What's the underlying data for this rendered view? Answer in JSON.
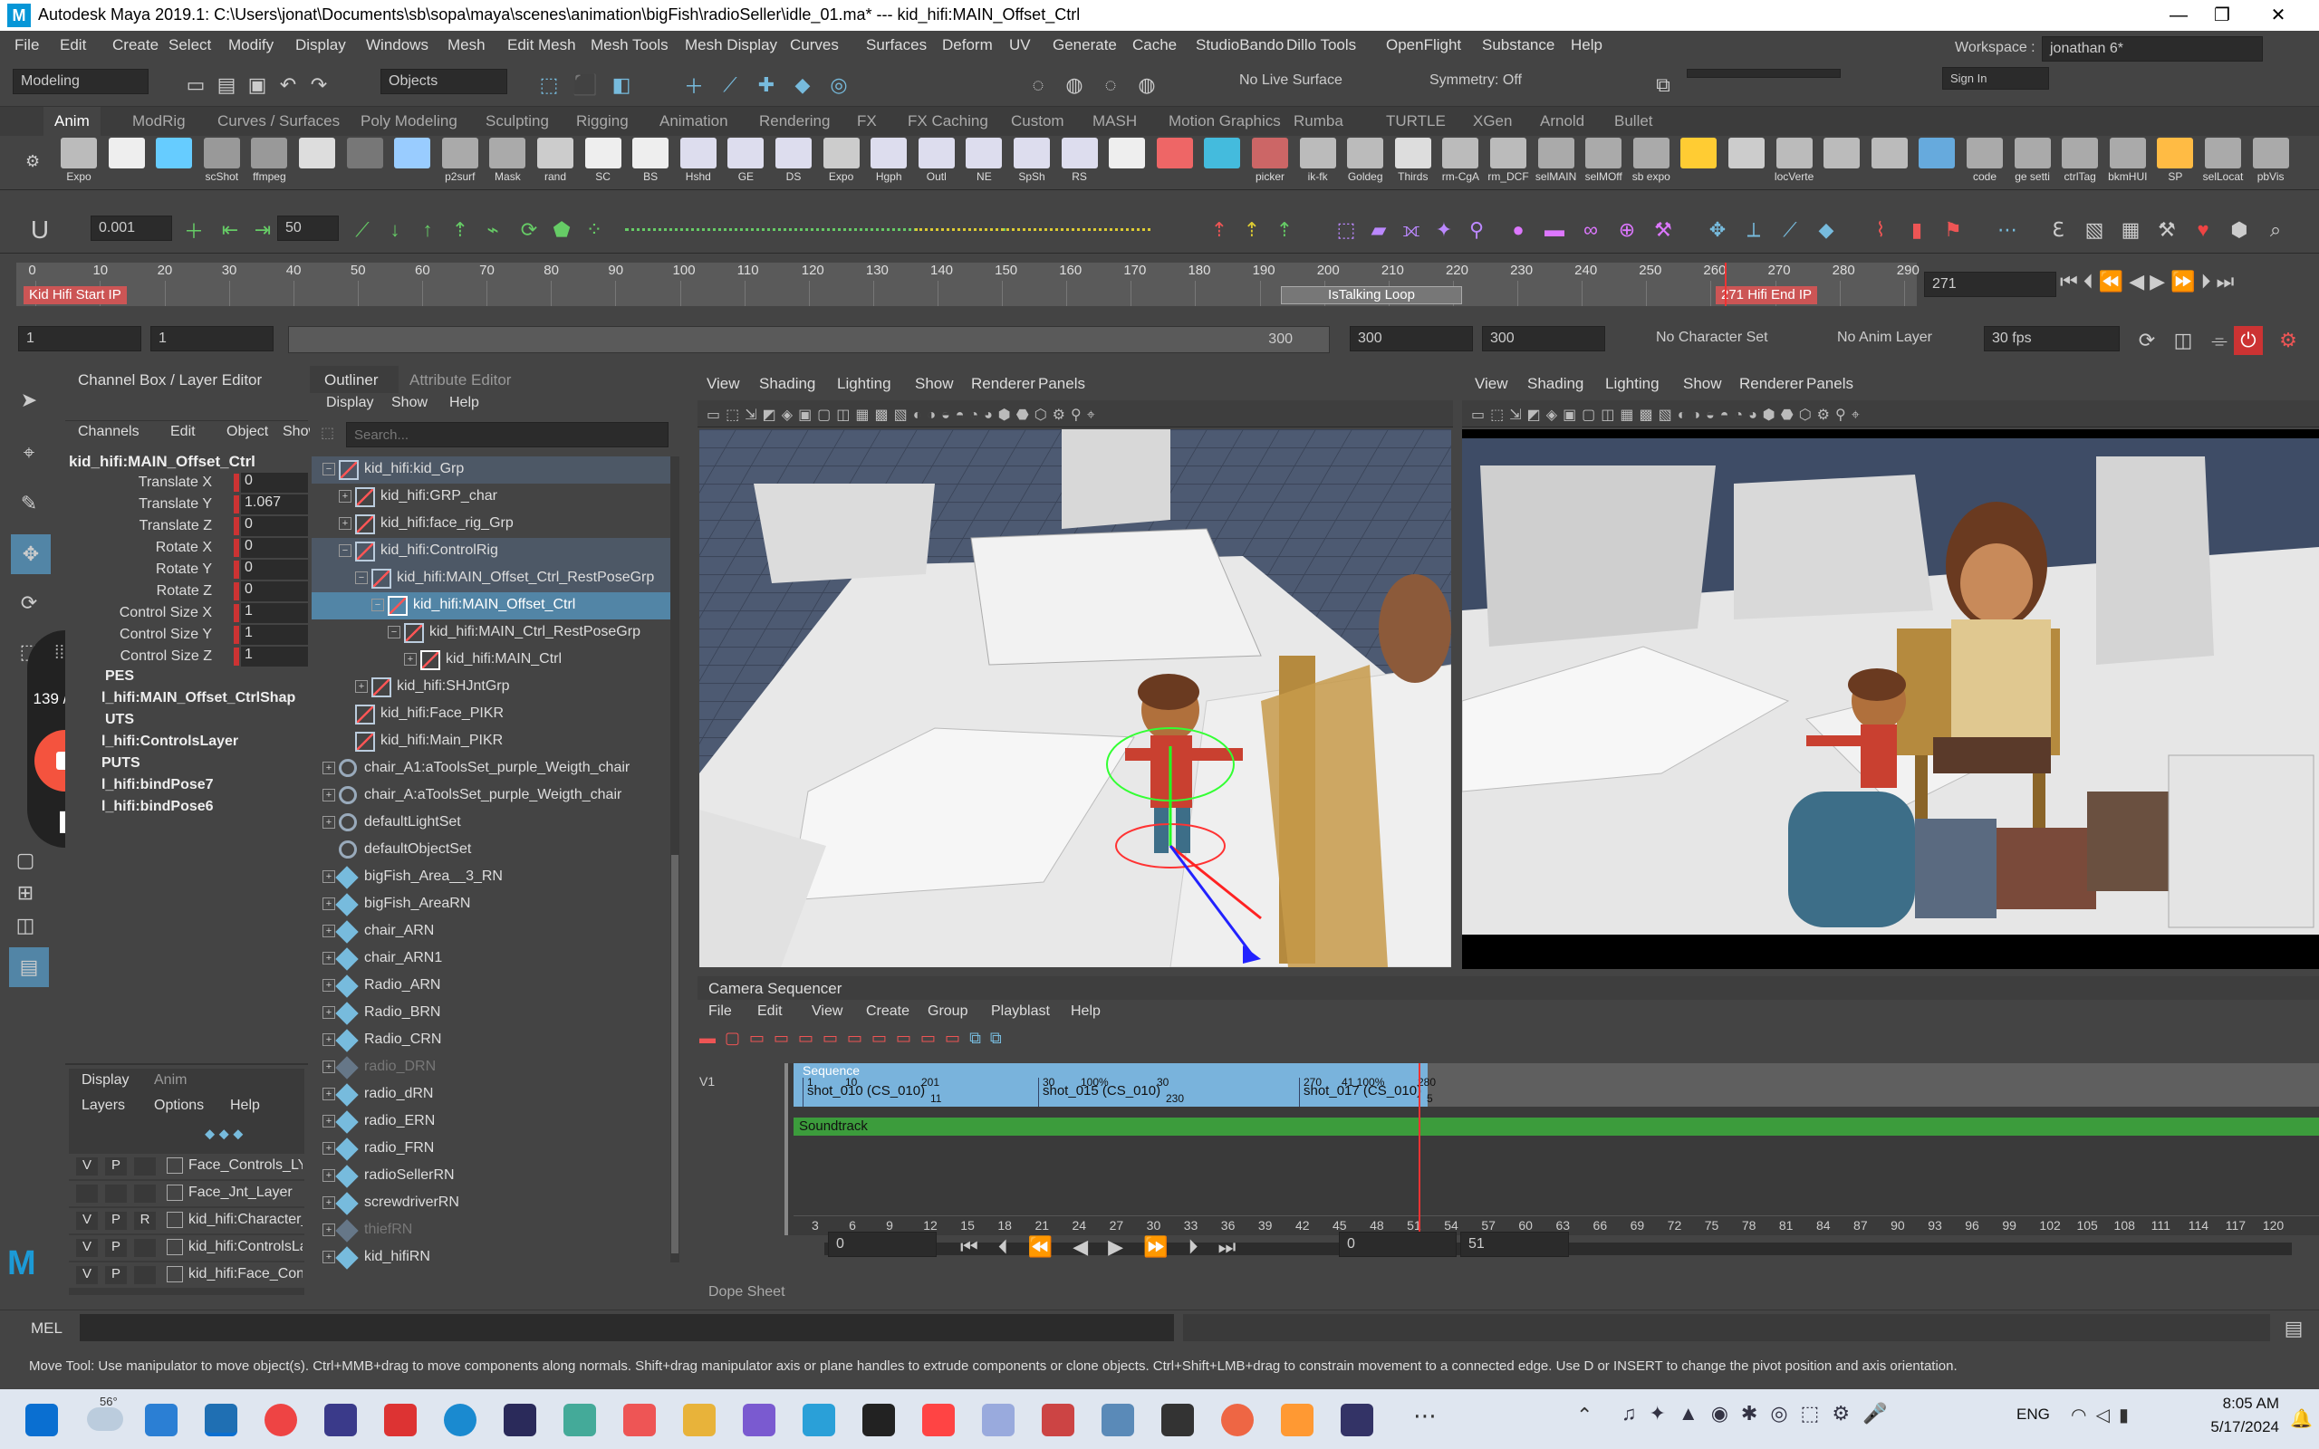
{
  "titlebar": {
    "title": "Autodesk Maya 2019.1: C:\\Users\\jonat\\Documents\\sb\\sopa\\maya\\scenes\\animation\\bigFish\\radioSeller\\idle_01.ma*  ---  kid_hifi:MAIN_Offset_Ctrl",
    "logo": "M",
    "min": "—",
    "max": "❐",
    "close": "✕"
  },
  "menu": [
    "File",
    "Edit",
    "Create",
    "Select",
    "Modify",
    "Display",
    "Windows",
    "Mesh",
    "Edit Mesh",
    "Mesh Tools",
    "Mesh Display",
    "Curves",
    "Surfaces",
    "Deform",
    "UV",
    "Generate",
    "Cache",
    "StudioBando",
    "Dillo Tools",
    "OpenFlight",
    "Substance",
    "Help"
  ],
  "status": {
    "mode": "Modeling",
    "objects": "Objects",
    "live_surface": "No Live Surface",
    "symmetry": "Symmetry: Off",
    "workspace_label": "Workspace :",
    "workspace": "jonathan 6*",
    "sign_in": "Sign In"
  },
  "shelf_tabs": [
    "Anim",
    "ModRig",
    "Curves / Surfaces",
    "Poly Modeling",
    "Sculpting",
    "Rigging",
    "Animation",
    "Rendering",
    "FX",
    "FX Caching",
    "Custom",
    "MASH",
    "Motion Graphics",
    "Rumba",
    "TURTLE",
    "XGen",
    "Arnold",
    "Bullet"
  ],
  "shelf_items": [
    {
      "l": "Expo",
      "c": "#bbb"
    },
    {
      "l": "",
      "c": "#eee"
    },
    {
      "l": "",
      "c": "#6cf"
    },
    {
      "l": "scShot",
      "c": "#999"
    },
    {
      "l": "ffmpeg",
      "c": "#999"
    },
    {
      "l": "",
      "c": "#ddd"
    },
    {
      "l": "",
      "c": "#777"
    },
    {
      "l": "",
      "c": "#9cf"
    },
    {
      "l": "p2surf",
      "c": "#aaa"
    },
    {
      "l": "Mask",
      "c": "#aaa"
    },
    {
      "l": "rand",
      "c": "#ccc"
    },
    {
      "l": "SC",
      "c": "#eee"
    },
    {
      "l": "BS",
      "c": "#eee"
    },
    {
      "l": "Hshd",
      "c": "#dde"
    },
    {
      "l": "GE",
      "c": "#dde"
    },
    {
      "l": "DS",
      "c": "#dde"
    },
    {
      "l": "Expo",
      "c": "#ccc"
    },
    {
      "l": "Hgph",
      "c": "#dde"
    },
    {
      "l": "Outl",
      "c": "#dde"
    },
    {
      "l": "NE",
      "c": "#dde"
    },
    {
      "l": "SpSh",
      "c": "#dde"
    },
    {
      "l": "RS",
      "c": "#dde"
    },
    {
      "l": "",
      "c": "#eee"
    },
    {
      "l": "",
      "c": "#e66"
    },
    {
      "l": "",
      "c": "#4bd"
    },
    {
      "l": "picker",
      "c": "#c66"
    },
    {
      "l": "ik-fk",
      "c": "#bbb"
    },
    {
      "l": "Goldeg",
      "c": "#bbb"
    },
    {
      "l": "Thirds",
      "c": "#ddd"
    },
    {
      "l": "rm-CgA",
      "c": "#bbb"
    },
    {
      "l": "rm_DCF",
      "c": "#bbb"
    },
    {
      "l": "selMAIN",
      "c": "#aaa"
    },
    {
      "l": "selMOff",
      "c": "#aaa"
    },
    {
      "l": "sb expo",
      "c": "#aaa"
    },
    {
      "l": "",
      "c": "#fc3"
    },
    {
      "l": "",
      "c": "#ccc"
    },
    {
      "l": "locVerte",
      "c": "#bbb"
    },
    {
      "l": "",
      "c": "#bbb"
    },
    {
      "l": "",
      "c": "#bbb"
    },
    {
      "l": "",
      "c": "#6ad"
    },
    {
      "l": "code",
      "c": "#aaa"
    },
    {
      "l": "ge setti",
      "c": "#aaa"
    },
    {
      "l": "ctrlTag",
      "c": "#aaa"
    },
    {
      "l": "bkmHUI",
      "c": "#aaa"
    },
    {
      "l": "SP",
      "c": "#fb4"
    },
    {
      "l": "selLocat",
      "c": "#aaa"
    },
    {
      "l": "pbVis",
      "c": "#aaa"
    }
  ],
  "toolbar2": {
    "value1": "0.001",
    "value2": "50"
  },
  "timeslider": {
    "ticks": [
      "0",
      "10",
      "20",
      "30",
      "40",
      "50",
      "60",
      "70",
      "80",
      "90",
      "100",
      "110",
      "120",
      "130",
      "140",
      "150",
      "160",
      "170",
      "180",
      "190",
      "200",
      "210",
      "220",
      "230",
      "240",
      "250",
      "260",
      "270",
      "280",
      "290"
    ],
    "current": "271",
    "marker_start": "Kid Hifi Start IP",
    "marker_talk": "IsTalking Loop",
    "marker_end": "Hifi End IP",
    "marker_end_frame": "271"
  },
  "range": {
    "start": "1",
    "start2": "1",
    "end_slider": "300",
    "end1": "300",
    "end2": "300",
    "char_set": "No Character Set",
    "anim_layer": "No Anim Layer",
    "fps": "30 fps"
  },
  "channelbox": {
    "tab1": "Channel Box / Layer Editor",
    "menus": [
      "Channels",
      "Edit",
      "Object",
      "Show"
    ],
    "node": "kid_hifi:MAIN_Offset_Ctrl",
    "attrs": [
      {
        "n": "Translate X",
        "v": "0"
      },
      {
        "n": "Translate Y",
        "v": "1.067"
      },
      {
        "n": "Translate Z",
        "v": "0"
      },
      {
        "n": "Rotate X",
        "v": "0"
      },
      {
        "n": "Rotate Y",
        "v": "0"
      },
      {
        "n": "Rotate Z",
        "v": "0"
      },
      {
        "n": "Control Size X",
        "v": "1"
      },
      {
        "n": "Control Size Y",
        "v": "1"
      },
      {
        "n": "Control Size Z",
        "v": "1"
      }
    ],
    "shapes_hdr": "PES",
    "shape": "l_hifi:MAIN_Offset_CtrlShap",
    "inputs_hdr": "UTS",
    "input": "l_hifi:ControlsLayer",
    "outputs_hdr": "PUTS",
    "out1": "l_hifi:bindPose7",
    "out2": "l_hifi:bindPose6",
    "rec_count": "139 / 200"
  },
  "layers": {
    "tabs": [
      "Display",
      "Anim"
    ],
    "menus": [
      "Layers",
      "Options",
      "Help"
    ],
    "rows": [
      {
        "v": "V",
        "p": "P",
        "r": "",
        "n": "Face_Controls_LYR"
      },
      {
        "v": "",
        "p": "",
        "r": "",
        "n": "Face_Jnt_Layer"
      },
      {
        "v": "V",
        "p": "P",
        "r": "R",
        "n": "kid_hifi:Character_"
      },
      {
        "v": "V",
        "p": "P",
        "r": "",
        "n": "kid_hifi:ControlsLa"
      },
      {
        "v": "V",
        "p": "P",
        "r": "",
        "n": "kid_hifi:Face_Contr"
      }
    ]
  },
  "outliner": {
    "tab1": "Outliner",
    "tab2": "Attribute Editor",
    "menus": [
      "Display",
      "Show",
      "Help"
    ],
    "search": "Search...",
    "rows": [
      {
        "t": "kid_hifi:kid_Grp",
        "d": 1,
        "ex": "−",
        "k": "grp",
        "s": "hl"
      },
      {
        "t": "kid_hifi:GRP_char",
        "d": 2,
        "ex": "+",
        "k": "grp"
      },
      {
        "t": "kid_hifi:face_rig_Grp",
        "d": 2,
        "ex": "+",
        "k": "grp"
      },
      {
        "t": "kid_hifi:ControlRig",
        "d": 2,
        "ex": "−",
        "k": "grp",
        "s": "hl"
      },
      {
        "t": "kid_hifi:MAIN_Offset_Ctrl_RestPoseGrp",
        "d": 3,
        "ex": "−",
        "k": "grp",
        "s": "hl"
      },
      {
        "t": "kid_hifi:MAIN_Offset_Ctrl",
        "d": 4,
        "ex": "−",
        "k": "crv",
        "s": "sel"
      },
      {
        "t": "kid_hifi:MAIN_Ctrl_RestPoseGrp",
        "d": 5,
        "ex": "−",
        "k": "grp"
      },
      {
        "t": "kid_hifi:MAIN_Ctrl",
        "d": 6,
        "ex": "+",
        "k": "crv"
      },
      {
        "t": "kid_hifi:SHJntGrp",
        "d": 3,
        "ex": "+",
        "k": "grp"
      },
      {
        "t": "kid_hifi:Face_PIKR",
        "d": 2,
        "ex": "",
        "k": "grp"
      },
      {
        "t": "kid_hifi:Main_PIKR",
        "d": 2,
        "ex": "",
        "k": "grp"
      },
      {
        "t": "chair_A1:aToolsSet_purple_Weigth_chair",
        "d": 1,
        "ex": "+",
        "k": "set"
      },
      {
        "t": "chair_A:aToolsSet_purple_Weigth_chair",
        "d": 1,
        "ex": "+",
        "k": "set"
      },
      {
        "t": "defaultLightSet",
        "d": 1,
        "ex": "+",
        "k": "set"
      },
      {
        "t": "defaultObjectSet",
        "d": 1,
        "ex": "",
        "k": "set"
      },
      {
        "t": "bigFish_Area__3_RN",
        "d": 1,
        "ex": "+",
        "k": "ref"
      },
      {
        "t": "bigFish_AreaRN",
        "d": 1,
        "ex": "+",
        "k": "ref"
      },
      {
        "t": "chair_ARN",
        "d": 1,
        "ex": "+",
        "k": "ref"
      },
      {
        "t": "chair_ARN1",
        "d": 1,
        "ex": "+",
        "k": "ref"
      },
      {
        "t": "Radio_ARN",
        "d": 1,
        "ex": "+",
        "k": "ref"
      },
      {
        "t": "Radio_BRN",
        "d": 1,
        "ex": "+",
        "k": "ref"
      },
      {
        "t": "Radio_CRN",
        "d": 1,
        "ex": "+",
        "k": "ref"
      },
      {
        "t": "radio_DRN",
        "d": 1,
        "ex": "+",
        "k": "refx",
        "s": "dim"
      },
      {
        "t": "radio_dRN",
        "d": 1,
        "ex": "+",
        "k": "ref"
      },
      {
        "t": "radio_ERN",
        "d": 1,
        "ex": "+",
        "k": "ref"
      },
      {
        "t": "radio_FRN",
        "d": 1,
        "ex": "+",
        "k": "ref"
      },
      {
        "t": "radioSellerRN",
        "d": 1,
        "ex": "+",
        "k": "ref"
      },
      {
        "t": "screwdriverRN",
        "d": 1,
        "ex": "+",
        "k": "ref"
      },
      {
        "t": "thiefRN",
        "d": 1,
        "ex": "+",
        "k": "refx",
        "s": "dim"
      },
      {
        "t": "kid_hifiRN",
        "d": 1,
        "ex": "+",
        "k": "ref"
      }
    ]
  },
  "viewport_menus": [
    "View",
    "Shading",
    "Lighting",
    "Show",
    "Renderer",
    "Panels"
  ],
  "sequencer": {
    "title": "Camera Sequencer",
    "menus": [
      "File",
      "Edit",
      "View",
      "Create",
      "Group",
      "Playblast",
      "Help"
    ],
    "track_label": "V1",
    "sequence_label": "Sequence",
    "shots": [
      {
        "name": "shot_010 (CS_010)",
        "a": "1",
        "b": "10",
        "c": "201",
        "d": "11"
      },
      {
        "name": "shot_015 (CS_010)",
        "a": "30",
        "b": "100%",
        "c": "30",
        "d": "230"
      },
      {
        "name": "shot_017 (CS_010)",
        "a": "270",
        "b": "41 100%",
        "c": "280",
        "d": "5"
      }
    ],
    "soundtrack": "Soundtrack",
    "ticks": [
      "3",
      "6",
      "9",
      "12",
      "15",
      "18",
      "21",
      "24",
      "27",
      "30",
      "33",
      "36",
      "39",
      "42",
      "45",
      "48",
      "51",
      "54",
      "57",
      "60",
      "63",
      "66",
      "69",
      "72",
      "75",
      "78",
      "81",
      "84",
      "87",
      "90",
      "93",
      "96",
      "99",
      "102",
      "105",
      "108",
      "111",
      "114",
      "117",
      "120"
    ],
    "field1": "0",
    "field2": "0",
    "field3": "51",
    "dopesheet": "Dope Sheet"
  },
  "cmdline": {
    "lang": "MEL"
  },
  "helpline": "Move Tool: Use manipulator to move object(s). Ctrl+MMB+drag to move components along normals. Shift+drag manipulator axis or plane handles to extrude components or clone objects. Ctrl+Shift+LMB+drag to constrain movement to a connected edge. Use D or INSERT to change the pivot position and axis orientation.",
  "taskbar": {
    "weather": "56°",
    "lang": "ENG",
    "time": "8:05 AM",
    "date": "5/17/2024"
  }
}
